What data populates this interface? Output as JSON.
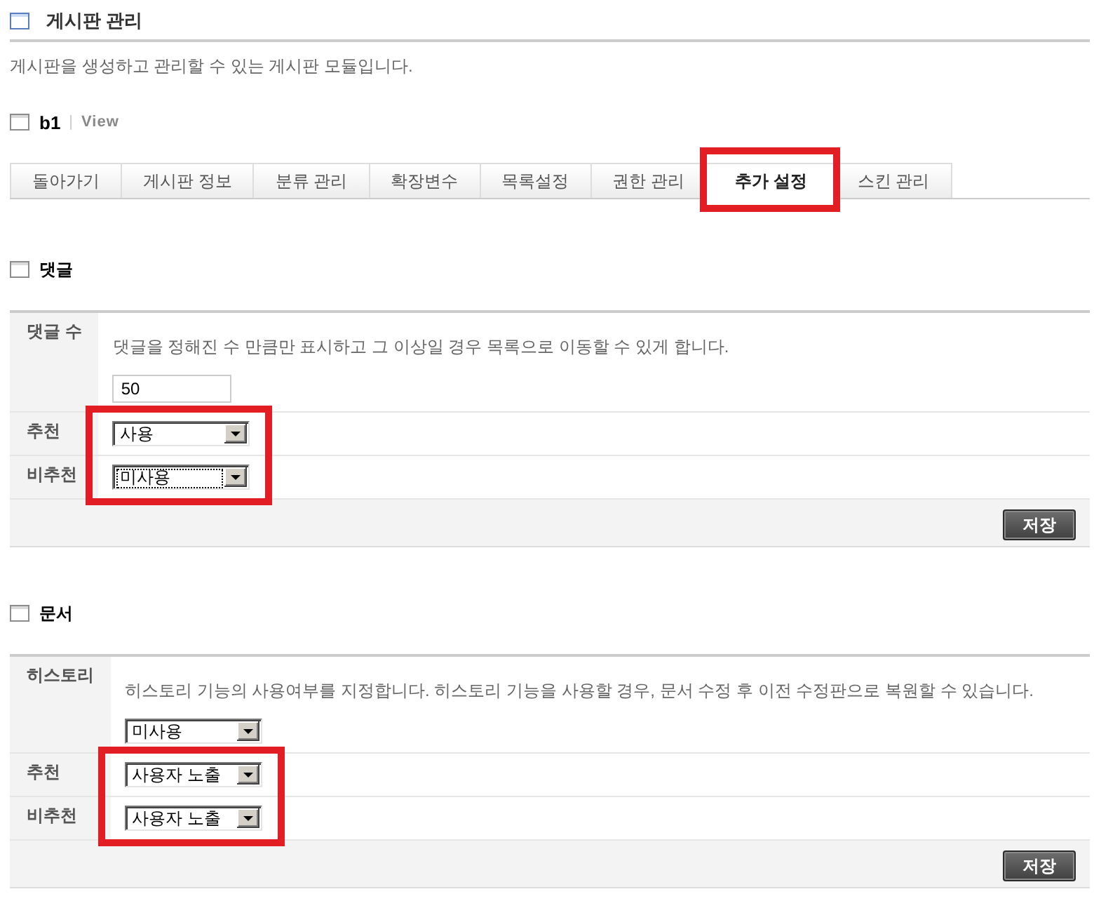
{
  "page": {
    "title": "게시판 관리",
    "description": "게시판을 생성하고 관리할 수 있는 게시판 모듈입니다."
  },
  "module": {
    "name": "b1",
    "separator": "|",
    "act": "View"
  },
  "tabs": [
    {
      "label": "돌아가기",
      "selected": false,
      "highlighted": false
    },
    {
      "label": "게시판 정보",
      "selected": false,
      "highlighted": false
    },
    {
      "label": "분류 관리",
      "selected": false,
      "highlighted": false
    },
    {
      "label": "확장변수",
      "selected": false,
      "highlighted": false
    },
    {
      "label": "목록설정",
      "selected": false,
      "highlighted": false
    },
    {
      "label": "권한 관리",
      "selected": false,
      "highlighted": false
    },
    {
      "label": "추가 설정",
      "selected": true,
      "highlighted": true
    },
    {
      "label": "스킨 관리",
      "selected": false,
      "highlighted": false
    }
  ],
  "sections": [
    {
      "title": "댓글",
      "rows": [
        {
          "label": "댓글 수",
          "description": "댓글을 정해진 수 만큼만 표시하고 그 이상일 경우 목록으로 이동할 수 있게 합니다.",
          "control": {
            "kind": "input",
            "value": "50"
          },
          "highlighted": false
        },
        {
          "label": "추천",
          "control": {
            "kind": "select",
            "value": "사용",
            "focused": false
          },
          "highlighted": true
        },
        {
          "label": "비추천",
          "control": {
            "kind": "select",
            "value": "미사용",
            "focused": true
          },
          "highlighted": true
        }
      ],
      "save_button": "저장"
    },
    {
      "title": "문서",
      "rows": [
        {
          "label": "히스토리",
          "description": "히스토리 기능의 사용여부를 지정합니다. 히스토리 기능을 사용할 경우, 문서 수정 후 이전 수정판으로 복원할 수 있습니다.",
          "control": {
            "kind": "select",
            "value": "미사용",
            "focused": false
          },
          "highlighted": false
        },
        {
          "label": "추천",
          "control": {
            "kind": "select",
            "value": "사용자 노출",
            "focused": false
          },
          "highlighted": true
        },
        {
          "label": "비추천",
          "control": {
            "kind": "select",
            "value": "사용자 노출",
            "focused": false
          },
          "highlighted": true
        }
      ],
      "save_button": "저장"
    }
  ]
}
